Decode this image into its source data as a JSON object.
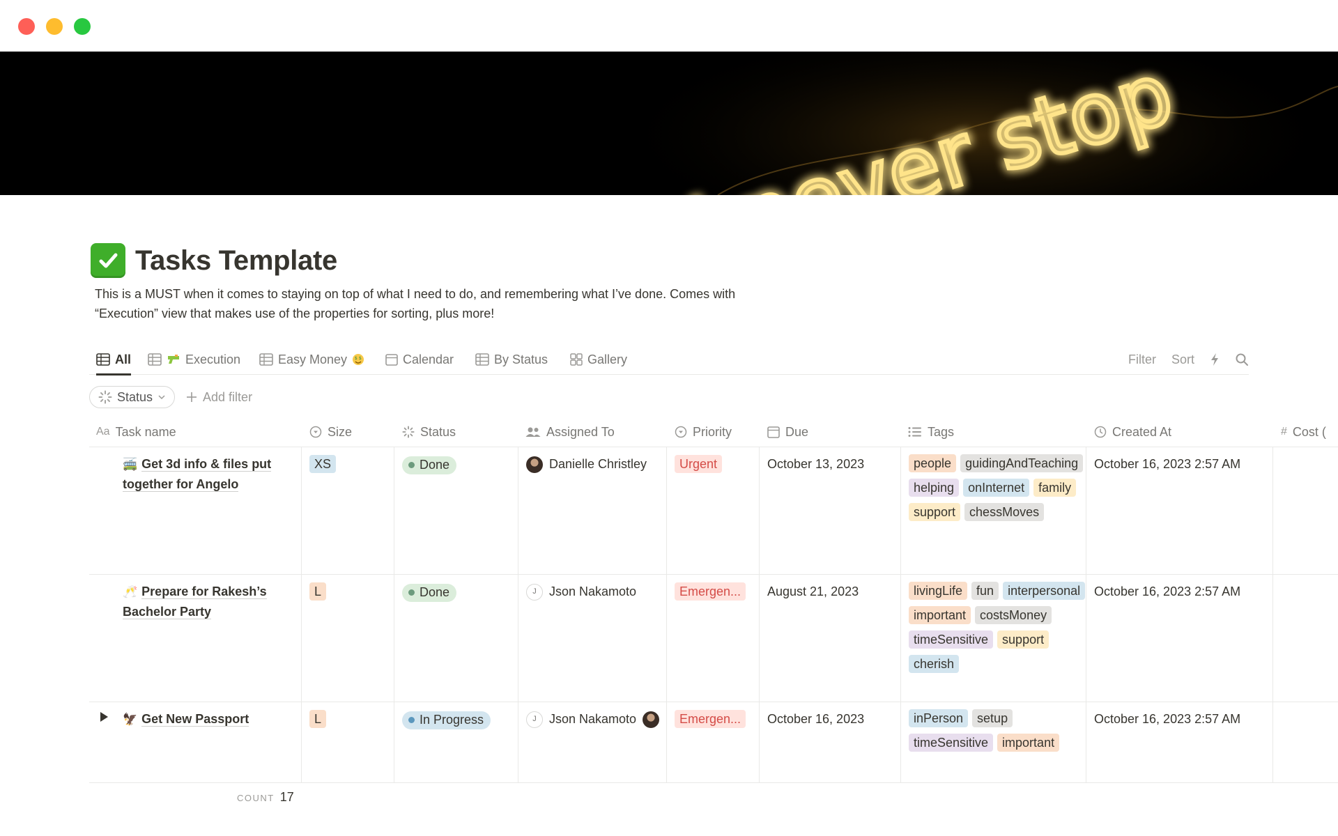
{
  "page": {
    "title": "Tasks Template",
    "description_line1": "This is a MUST when it comes to staying on top of what I need to do, and remembering what I’ve done. Comes with",
    "description_line2": "“Execution” view that makes use of the properties for sorting, plus more!",
    "cover_text": "d never stop"
  },
  "views": {
    "tabs": [
      "All",
      "Execution",
      "Easy Money",
      "Calendar",
      "By Status",
      "Gallery"
    ],
    "filter": "Filter",
    "sort": "Sort"
  },
  "filters": {
    "status": "Status",
    "add_filter": "Add filter"
  },
  "table": {
    "columns": [
      "Task name",
      "Size",
      "Status",
      "Assigned To",
      "Priority",
      "Due",
      "Tags",
      "Created At",
      "Cost ("
    ],
    "rows": [
      {
        "emoji": "🚎",
        "name_line1": "Get 3d info & files put",
        "name_line2": "together for Angelo",
        "size": "XS",
        "status": "Done",
        "assignee": "Danielle Christley",
        "priority": "Urgent",
        "due": "October 13, 2023",
        "tags": [
          "people",
          "guidingAndTeaching",
          "helping",
          "onInternet",
          "family",
          "support",
          "chessMoves"
        ],
        "created": "October 16, 2023 2:57 AM"
      },
      {
        "emoji": "🥂",
        "name_line1": "Prepare for Rakesh’s",
        "name_line2": "Bachelor Party",
        "size": "L",
        "status": "Done",
        "assignee_initial": "J",
        "assignee": "Json Nakamoto",
        "priority": "Emergen...",
        "due": "August 21, 2023",
        "tags": [
          "livingLife",
          "fun",
          "interpersonal",
          "important",
          "costsMoney",
          "timeSensitive",
          "support",
          "cherish"
        ],
        "created": "October 16, 2023 2:57 AM"
      },
      {
        "emoji": "🦅",
        "name_line1": "Get New Passport",
        "size": "L",
        "status": "In Progress",
        "assignee_initial": "J",
        "assignee": "Json Nakamoto",
        "priority": "Emergen...",
        "due": "October 16, 2023",
        "tags": [
          "inPerson",
          "setup",
          "timeSensitive",
          "important"
        ],
        "created": "October 16, 2023 2:57 AM"
      }
    ]
  },
  "footer": {
    "label": "COUNT",
    "count": "17"
  },
  "colors": {
    "done_bg": "#dbeddb",
    "done_dot": "#6c9b7d",
    "progress_bg": "#d3e5ef",
    "progress_dot": "#5b97bd",
    "urgent_bg": "#ffe2dd",
    "urgent_text": "#d44c47",
    "size_xs_bg": "#d3e5ef",
    "size_l_bg": "#fadec9"
  }
}
